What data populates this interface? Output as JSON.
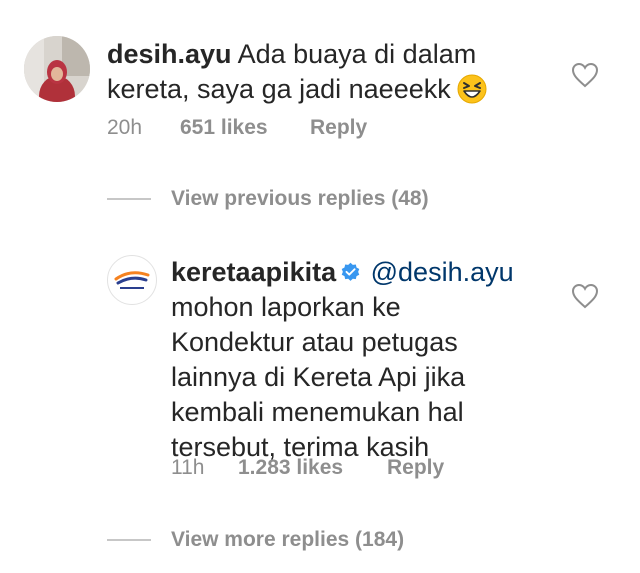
{
  "comment": {
    "username": "desih.ayu",
    "line1": "Ada buaya di dalam",
    "line2": "kereta, saya ga jadi naeeekk",
    "emoji": "laughing-face",
    "time": "20h",
    "likes": "651 likes",
    "reply_label": "Reply"
  },
  "view_previous": "View previous replies (48)",
  "reply": {
    "username": "keretaapikita",
    "verified": true,
    "mention": "@desih.ayu",
    "lines": [
      "mohon laporkan ke",
      "Kondektur atau petugas",
      "lainnya di Kereta Api jika",
      "kembali menemukan hal",
      "tersebut, terima kasih"
    ],
    "time": "11h",
    "likes": "1.283 likes",
    "reply_label": "Reply"
  },
  "view_more": "View more replies (184)",
  "colors": {
    "text": "#262626",
    "muted": "#8e8e8e",
    "mention": "#00376b",
    "verified": "#3897f0"
  }
}
